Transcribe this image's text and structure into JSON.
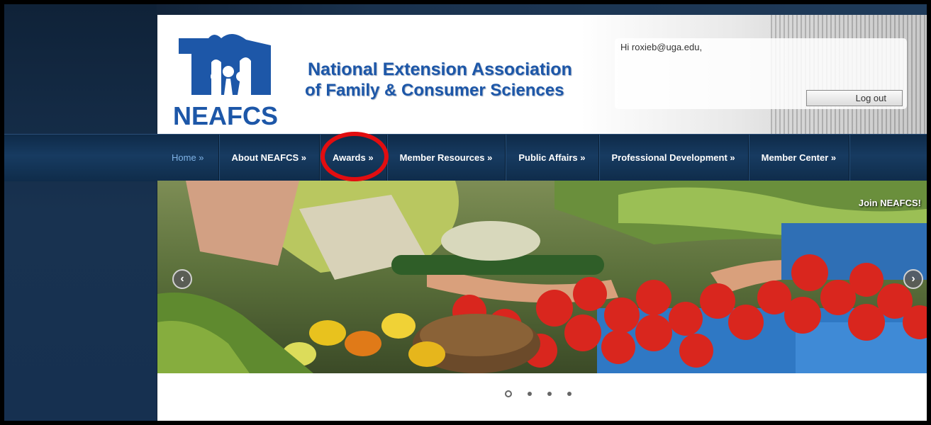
{
  "header": {
    "org_name_line1": "National Extension Association",
    "org_name_line2": "of Family & Consumer Sciences",
    "logo_text": "NEAFCS",
    "logo_color": "#1d57a8"
  },
  "user": {
    "greeting": "Hi roxieb@uga.edu,",
    "logout_label": "Log out"
  },
  "nav": {
    "items": [
      {
        "label": "Home »",
        "active": true
      },
      {
        "label": "About NEAFCS »",
        "active": false
      },
      {
        "label": "Awards »",
        "active": false,
        "highlighted": true
      },
      {
        "label": "Member Resources »",
        "active": false
      },
      {
        "label": "Public Affairs »",
        "active": false
      },
      {
        "label": "Professional Development »",
        "active": false
      },
      {
        "label": "Member Center »",
        "active": false
      }
    ]
  },
  "slider": {
    "caption": "Join NEAFCS!",
    "prev_icon": "chevron-left-icon",
    "next_icon": "chevron-right-icon",
    "slide_count": 4,
    "active_index": 0
  },
  "colors": {
    "nav_active_text": "#7fb2e5",
    "highlight_circle": "#e20d10"
  }
}
